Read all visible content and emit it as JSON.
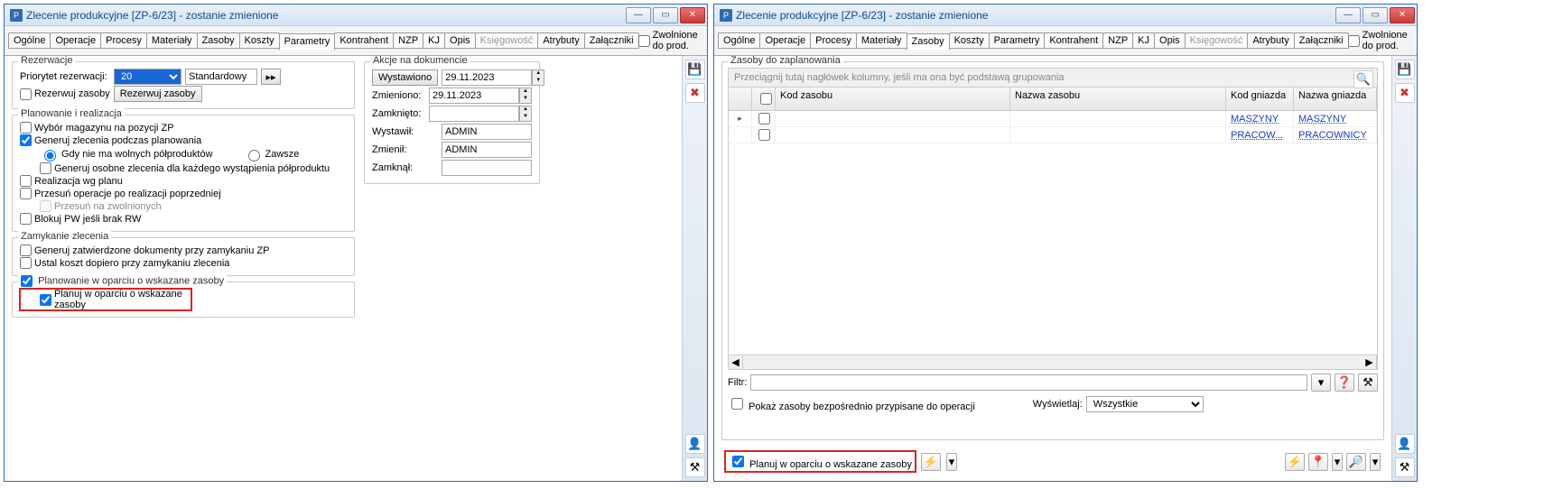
{
  "titleBoth": "Zlecenie produkcyjne  [ZP-6/23] - zostanie zmienione",
  "tabs": [
    "Ogólne",
    "Operacje",
    "Procesy",
    "Materiały",
    "Zasoby",
    "Koszty",
    "Parametry",
    "Kontrahent",
    "NZP",
    "KJ",
    "Opis",
    "Księgowość",
    "Atrybuty",
    "Załączniki"
  ],
  "chk_zwolnione": "Zwolnione do prod.",
  "w1": {
    "active_tab": "Parametry",
    "rezerwacje": {
      "legend": "Rezerwacje",
      "priorytet_lbl": "Priorytet rezerwacji:",
      "priorytet_val": "20",
      "standardowy": "Standardowy",
      "spinbtn": "▸▸",
      "rezerwuj_chk": "Rezerwuj zasoby",
      "rezerwuj_btn": "Rezerwuj zasoby"
    },
    "planowanie": {
      "legend": "Planowanie i realizacja",
      "wybor_magazynu": "Wybór magazynu na pozycji ZP",
      "generuj": "Generuj zlecenia podczas planowania",
      "gdy": "Gdy nie ma wolnych półproduktów",
      "zawsze": "Zawsze",
      "generuj_osobne": "Generuj osobne zlecenia dla każdego wystąpienia półproduktu",
      "realizacja": "Realizacja wg planu",
      "przesun_op": "Przesuń operacje po realizacji poprzedniej",
      "przesun_zw": "Przesuń na zwolnionych",
      "blokuj_pw": "Blokuj PW jeśli brak RW"
    },
    "zamykanie": {
      "legend": "Zamykanie zlecenia",
      "generuj_dok": "Generuj zatwierdzone dokumenty przy zamykaniu ZP",
      "ustal_koszt": "Ustal koszt dopiero przy zamykaniu zlecenia"
    },
    "planuj_group": {
      "legend": "Planowanie w oparciu o wskazane zasoby",
      "chk": "Planuj w oparciu o wskazane zasoby"
    },
    "akcje": {
      "legend": "Akcje na dokumencie",
      "btn_wystawiono": "Wystawiono",
      "date1": "29.11.2023",
      "zmieniono": "Zmieniono:",
      "date2": "29.11.2023",
      "zamknieto": "Zamknięto:",
      "wystawil": "Wystawił:",
      "wystawil_v": "ADMIN",
      "zmienil": "Zmienił:",
      "zmienil_v": "ADMIN",
      "zamknal": "Zamknął:"
    }
  },
  "w2": {
    "active_tab": "Zasoby",
    "panel_legend": "Zasoby do zaplanowania",
    "drag_hint": "Przeciągnij tutaj nagłówek kolumny, jeśli ma ona być podstawą grupowania",
    "headers": {
      "c2": "Kod zasobu",
      "c3": "Nazwa zasobu",
      "c4": "Kod gniazda",
      "c5": "Nazwa gniazda"
    },
    "rows": [
      {
        "kod": "MASZYNY",
        "nazwa": "MASZYNY"
      },
      {
        "kod": "PRACOW...",
        "nazwa": "PRACOWNICY"
      }
    ],
    "filtr_lbl": "Filtr:",
    "pokaz_chk": "Pokaż zasoby bezpośrednio przypisane do operacji",
    "wyswietlaj_lbl": "Wyświetlaj:",
    "wyswietlaj_val": "Wszystkie",
    "planuj_chk": "Planuj w oparciu o wskazane zasoby"
  },
  "icons": {
    "save": "💾",
    "close": "✖",
    "search": "🔍",
    "person": "👤",
    "question": "❓",
    "funnel": "⚒",
    "bolt": "⚡",
    "pin": "📍",
    "magnify": "🔎",
    "down": "▾",
    "left": "◀",
    "right": "▶"
  }
}
